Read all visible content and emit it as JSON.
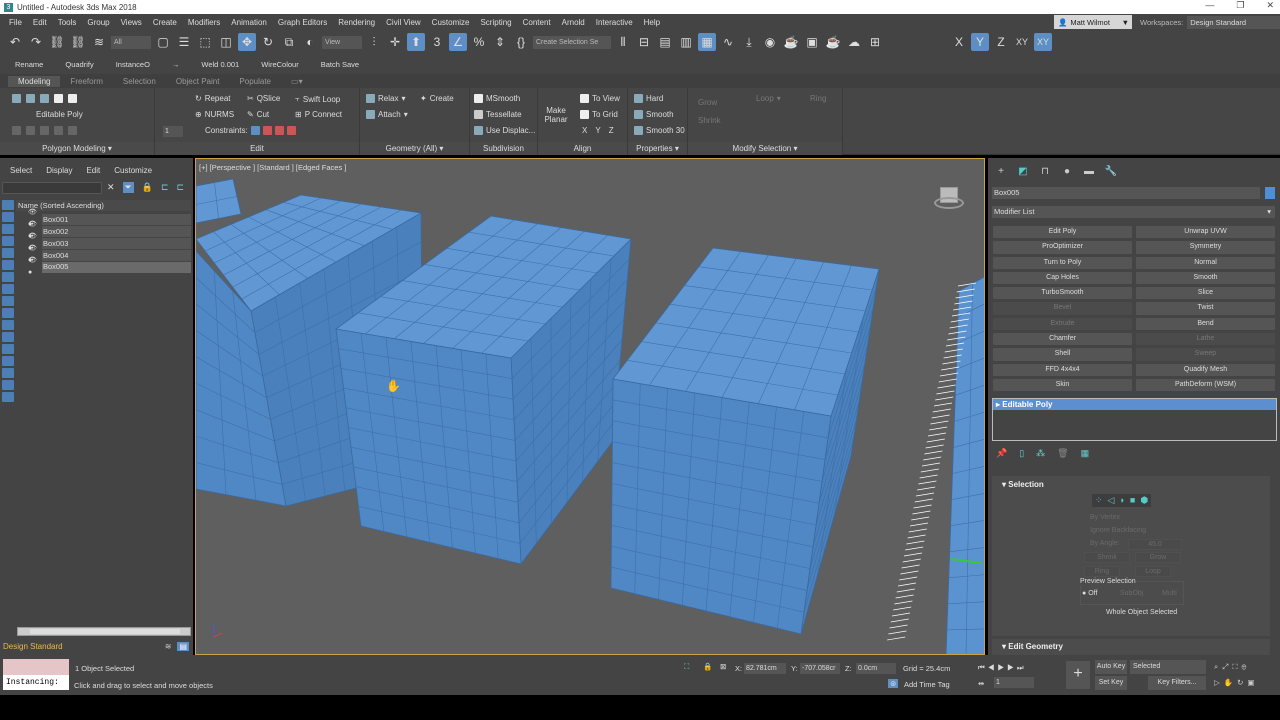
{
  "window": {
    "title": "Untitled - Autodesk 3ds Max 2018",
    "app_icon": "3",
    "controls": [
      "—",
      "❐",
      "✕"
    ]
  },
  "menu": [
    "File",
    "Edit",
    "Tools",
    "Group",
    "Views",
    "Create",
    "Modifiers",
    "Animation",
    "Graph Editors",
    "Rendering",
    "Civil View",
    "Customize",
    "Scripting",
    "Content",
    "Arnold",
    "Interactive",
    "Help"
  ],
  "user": {
    "name": "Matt Wilmot"
  },
  "workspace": {
    "label": "Workspaces:",
    "value": "Design Standard"
  },
  "maintoolbar": {
    "selection_filter": "All",
    "ref_coord": "View",
    "named_selection": "Create Selection Se",
    "axes": [
      "X",
      "Y",
      "Z",
      "XY",
      "XY"
    ]
  },
  "customtoolbar": [
    "Rename",
    "Quadrify",
    "InstanceO",
    "→",
    "Weld 0.001",
    "WireColour",
    "Batch Save"
  ],
  "ribbon": {
    "tabs": [
      "Modeling",
      "Freeform",
      "Selection",
      "Object Paint",
      "Populate"
    ],
    "groups": {
      "polygon_modeling": "Polygon Modeling ▾",
      "edit": "Edit",
      "geometry": "Geometry (All) ▾",
      "subdivision": "Subdivision",
      "align": "Align",
      "properties": "Properties ▾",
      "modify_selection": "Modify Selection ▾"
    },
    "editable_poly": "Editable Poly",
    "spinner": "1",
    "edit": {
      "repeat": "Repeat",
      "qslice": "QSlice",
      "swift_loop": "Swift Loop",
      "nurms": "NURMS",
      "cut": "Cut",
      "p_connect": "P Connect",
      "constraints": "Constraints:"
    },
    "geometry": {
      "relax": "Relax",
      "create": "Create",
      "attach": "Attach"
    },
    "subdivision": {
      "msmooth": "MSmooth",
      "tessellate": "Tessellate",
      "use_displace": "Use Displac..."
    },
    "align": {
      "make_planar": "Make Planar",
      "to_view": "To View",
      "to_grid": "To Grid",
      "x": "X",
      "y": "Y",
      "z": "Z"
    },
    "properties": {
      "hard": "Hard",
      "smooth": "Smooth",
      "smooth30": "Smooth 30"
    },
    "modify_selection": {
      "grow": "Grow",
      "shrink": "Shrink",
      "loop": "Loop",
      "ring": "Ring"
    }
  },
  "explorer": {
    "menu": [
      "Select",
      "Display",
      "Edit",
      "Customize"
    ],
    "header": "Name (Sorted Ascending)",
    "items": [
      "Box001",
      "Box002",
      "Box003",
      "Box004",
      "Box005"
    ],
    "selected": "Box005",
    "workspace": "Design Standard"
  },
  "viewport": {
    "label": "[+] [Perspective ] [Standard ] [Edged Faces ]"
  },
  "command_panel": {
    "object_name": "Box005",
    "modifier_list": "Modifier List",
    "modifiers": [
      {
        "label": "Edit Poly",
        "enabled": true
      },
      {
        "label": "Unwrap UVW",
        "enabled": true
      },
      {
        "label": "ProOptimizer",
        "enabled": true
      },
      {
        "label": "Symmetry",
        "enabled": true
      },
      {
        "label": "Turn to Poly",
        "enabled": true
      },
      {
        "label": "Normal",
        "enabled": true
      },
      {
        "label": "Cap Holes",
        "enabled": true
      },
      {
        "label": "Smooth",
        "enabled": true
      },
      {
        "label": "TurboSmooth",
        "enabled": true
      },
      {
        "label": "Slice",
        "enabled": true
      },
      {
        "label": "Bevel",
        "enabled": false
      },
      {
        "label": "Twist",
        "enabled": true
      },
      {
        "label": "Extrude",
        "enabled": false
      },
      {
        "label": "Bend",
        "enabled": true
      },
      {
        "label": "Chamfer",
        "enabled": true
      },
      {
        "label": "Lathe",
        "enabled": false
      },
      {
        "label": "Shell",
        "enabled": true
      },
      {
        "label": "Sweep",
        "enabled": false
      },
      {
        "label": "FFD 4x4x4",
        "enabled": true
      },
      {
        "label": "Quadify Mesh",
        "enabled": true
      },
      {
        "label": "Skin",
        "enabled": true
      },
      {
        "label": "PathDeform (WSM)",
        "enabled": true
      }
    ],
    "stack": [
      "Editable Poly"
    ],
    "selection": {
      "title": "Selection",
      "by_vertex": "By Vertex",
      "ignore_backfacing": "Ignore Backfacing",
      "by_angle": "By Angle:",
      "angle": "45.0",
      "shrink": "Shrink",
      "grow": "Grow",
      "ring": "Ring",
      "loop": "Loop",
      "preview": "Preview Selection",
      "off": "Off",
      "subobj": "SubObj",
      "multi": "Multi",
      "status": "Whole Object Selected"
    },
    "edit_geometry": "Edit Geometry"
  },
  "status": {
    "maxscript": "Instancing:",
    "selected": "1 Object Selected",
    "prompt": "Click and drag to select and move objects",
    "x_label": "X:",
    "x": "82.781cm",
    "y_label": "Y:",
    "y": "-707.058cr",
    "z_label": "Z:",
    "z": "0.0cm",
    "grid": "Grid = 25.4cm",
    "add_time_tag": "Add Time Tag",
    "auto_key": "Auto Key",
    "set_key": "Set Key",
    "key_mode": "Selected",
    "key_filters": "Key Filters...",
    "frame": "1"
  },
  "colors": {
    "accent": "#5d8ec4",
    "box_top": "#6198d4",
    "box_front": "#4f88c5",
    "viewport_border": "#c8a34a"
  }
}
